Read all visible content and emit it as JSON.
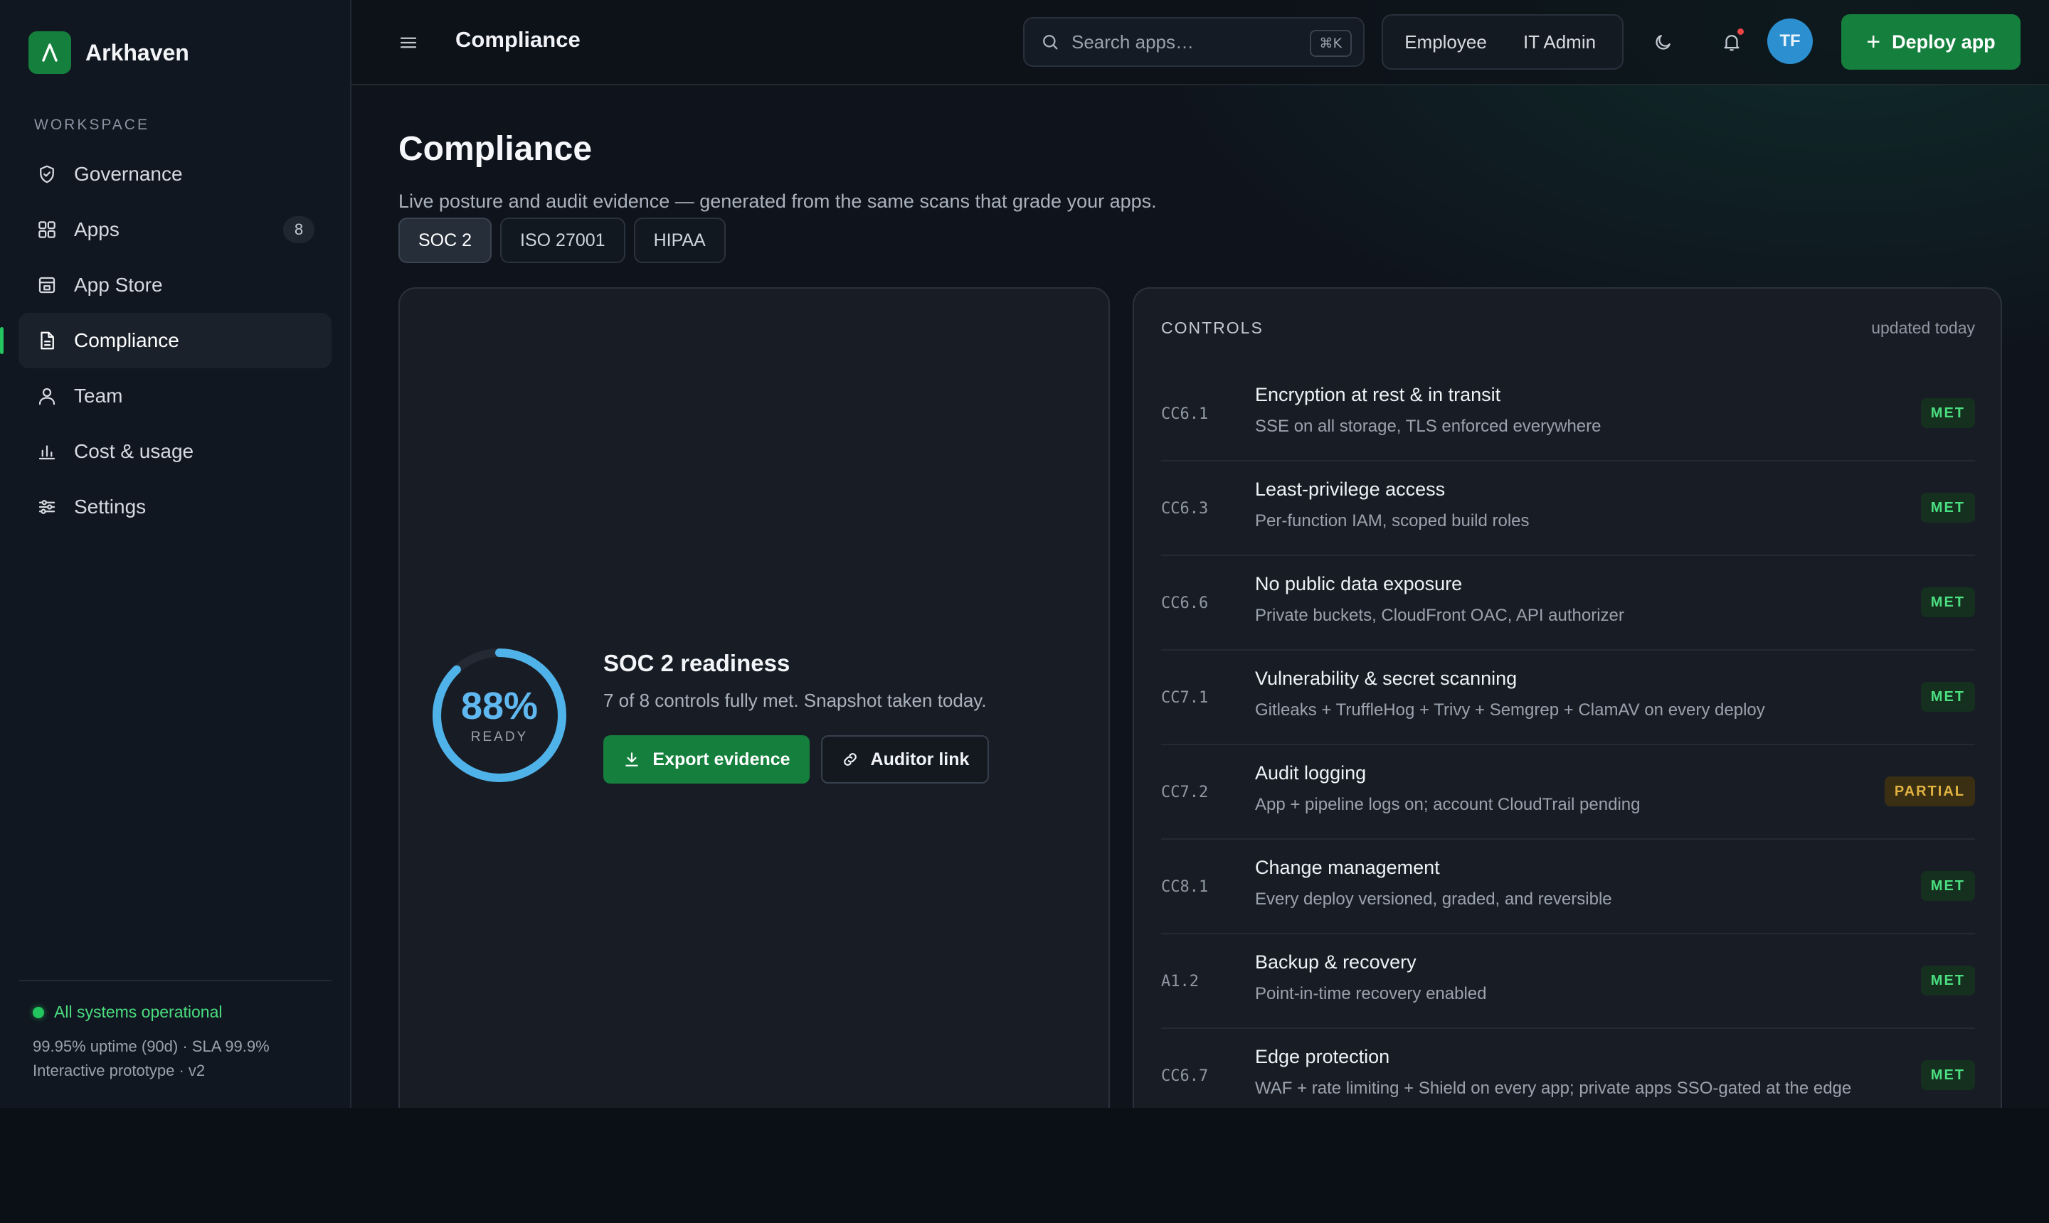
{
  "brand": {
    "name": "Arkhaven",
    "logo_letter": "A"
  },
  "sidebar": {
    "section_label": "WORKSPACE",
    "items": [
      {
        "label": "Governance",
        "icon": "shield-check-icon"
      },
      {
        "label": "Apps",
        "icon": "grid-icon",
        "badge": "8"
      },
      {
        "label": "App Store",
        "icon": "store-icon"
      },
      {
        "label": "Compliance",
        "icon": "document-icon",
        "active": true
      },
      {
        "label": "Team",
        "icon": "user-icon"
      },
      {
        "label": "Cost & usage",
        "icon": "bar-chart-icon"
      },
      {
        "label": "Settings",
        "icon": "sliders-icon"
      }
    ],
    "footer": {
      "status": "All systems operational",
      "uptime": "99.95% uptime (90d) · SLA 99.9%",
      "version": "Interactive prototype · v2"
    }
  },
  "topbar": {
    "title": "Compliance",
    "search_placeholder": "Search apps…",
    "search_shortcut": "⌘K",
    "roles": [
      "Employee",
      "IT Admin"
    ],
    "avatar_initials": "TF",
    "deploy_label": "Deploy app"
  },
  "page": {
    "title": "Compliance",
    "description": "Live posture and audit evidence — generated from the same scans that grade your apps.",
    "tabs": [
      "SOC 2",
      "ISO 27001",
      "HIPAA"
    ],
    "active_tab": "SOC 2"
  },
  "readiness": {
    "percent_value": 0.88,
    "percent_label": "88%",
    "gauge_sub": "READY",
    "title": "SOC 2 readiness",
    "description": "7 of 8 controls fully met. Snapshot taken today.",
    "export_label": "Export evidence",
    "auditor_label": "Auditor link"
  },
  "controls": {
    "heading": "CONTROLS",
    "updated": "updated today",
    "rows": [
      {
        "id": "CC6.1",
        "title": "Encryption at rest & in transit",
        "desc": "SSE on all storage, TLS enforced everywhere",
        "status": "MET"
      },
      {
        "id": "CC6.3",
        "title": "Least-privilege access",
        "desc": "Per-function IAM, scoped build roles",
        "status": "MET"
      },
      {
        "id": "CC6.6",
        "title": "No public data exposure",
        "desc": "Private buckets, CloudFront OAC, API authorizer",
        "status": "MET"
      },
      {
        "id": "CC7.1",
        "title": "Vulnerability & secret scanning",
        "desc": "Gitleaks + TruffleHog + Trivy + Semgrep + ClamAV on every deploy",
        "status": "MET"
      },
      {
        "id": "CC7.2",
        "title": "Audit logging",
        "desc": "App + pipeline logs on; account CloudTrail pending",
        "status": "PARTIAL"
      },
      {
        "id": "CC8.1",
        "title": "Change management",
        "desc": "Every deploy versioned, graded, and reversible",
        "status": "MET"
      },
      {
        "id": "A1.2",
        "title": "Backup & recovery",
        "desc": "Point-in-time recovery enabled",
        "status": "MET"
      },
      {
        "id": "CC6.7",
        "title": "Edge protection",
        "desc": "WAF + rate limiting + Shield on every app; private apps SSO-gated at the edge",
        "status": "MET"
      }
    ]
  },
  "colors": {
    "accent_green": "#15803d",
    "status_green": "#22c55e",
    "gauge_blue": "#4fb3ea",
    "partial_amber": "#e0b341"
  }
}
